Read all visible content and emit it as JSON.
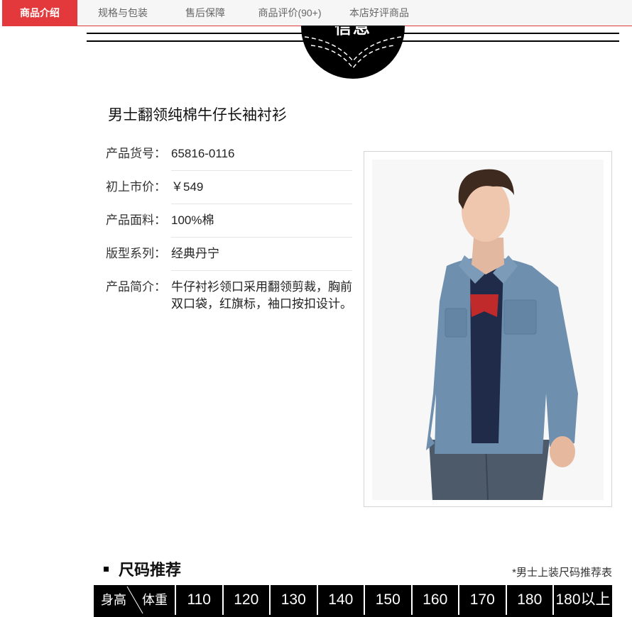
{
  "tabs": [
    {
      "label": "商品介绍",
      "active": true
    },
    {
      "label": "规格与包装",
      "active": false
    },
    {
      "label": "售后保障",
      "active": false
    },
    {
      "label": "商品评价(90+)",
      "active": false
    },
    {
      "label": "本店好评商品",
      "active": false
    }
  ],
  "header_badge": {
    "text": "信息"
  },
  "product": {
    "title": "男士翻领纯棉牛仔长袖衬衫",
    "fields": [
      {
        "label": "产品货号：",
        "value": "65816-0116"
      },
      {
        "label": "初上市价：",
        "value": "￥549"
      },
      {
        "label": "产品面料：",
        "value": "100%棉"
      },
      {
        "label": "版型系列：",
        "value": "经典丹宁"
      },
      {
        "label": "产品简介：",
        "value": "牛仔衬衫领口采用翻领剪裁，胸前双口袋，红旗标，袖口按扣设计。"
      }
    ]
  },
  "size_section": {
    "title": "尺码推荐",
    "note": "*男士上装尺码推荐表",
    "head_left": "身高",
    "head_right": "体重",
    "columns": [
      "110",
      "120",
      "130",
      "140",
      "150",
      "160",
      "170",
      "180",
      "180以上"
    ]
  },
  "colors": {
    "accent": "#e4393c",
    "tab_bg": "#f6f6f6"
  }
}
